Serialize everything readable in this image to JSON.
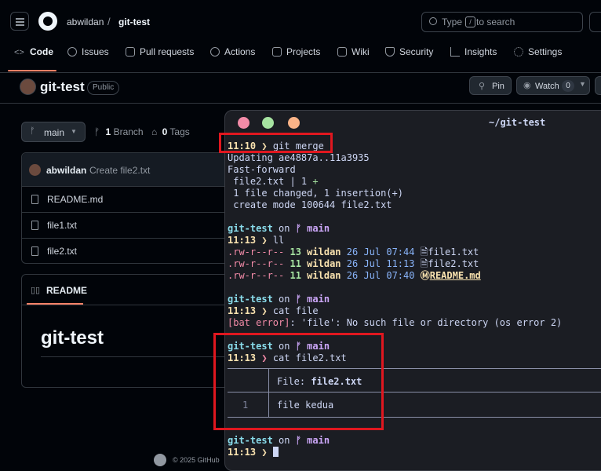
{
  "header": {
    "owner": "abwildan",
    "separator": "/",
    "repo": "git-test",
    "search_placeholder_a": "Type",
    "search_key": "/",
    "search_placeholder_b": "to search"
  },
  "nav_tabs": [
    {
      "label": "Code",
      "icon": "code-icon"
    },
    {
      "label": "Issues",
      "icon": "issue-icon"
    },
    {
      "label": "Pull requests",
      "icon": "pull-request-icon"
    },
    {
      "label": "Actions",
      "icon": "play-icon"
    },
    {
      "label": "Projects",
      "icon": "table-icon"
    },
    {
      "label": "Wiki",
      "icon": "book-icon"
    },
    {
      "label": "Security",
      "icon": "shield-icon"
    },
    {
      "label": "Insights",
      "icon": "graph-icon"
    },
    {
      "label": "Settings",
      "icon": "gear-icon"
    }
  ],
  "repo": {
    "name": "git-test",
    "visibility": "Public",
    "pin_label": "Pin",
    "watch_label": "Watch",
    "watch_count": "0"
  },
  "branch": {
    "current": "main",
    "branch_count": "1",
    "branch_label": "Branch",
    "tag_count": "0",
    "tag_label": "Tags"
  },
  "commit": {
    "author": "abwildan",
    "message": "Create file2.txt"
  },
  "files": [
    "README.md",
    "file1.txt",
    "file2.txt"
  ],
  "readme": {
    "tab_label": "README",
    "heading": "git-test"
  },
  "footer": {
    "text": "© 2025 GitHub"
  },
  "terminal": {
    "title": "~/git-test",
    "colors": {
      "close": "#f38ba8",
      "minimize": "#a6e3a1",
      "maximize": "#fab387",
      "highlight": "#e0171f"
    },
    "lines": {
      "l1_time": "11:10",
      "l1_arrow": "❯",
      "l1_cmd": "git merge",
      "l2": "Updating ae4887a..11a3935",
      "l3": "Fast-forward",
      "l4_a": " file2.txt | 1 ",
      "l4_plus": "+",
      "l5": " 1 file changed, 1 insertion(+)",
      "l6": " create mode 100644 file2.txt",
      "p_dir": "git-test",
      "p_on": "on",
      "p_branch_icon": "ᚠ",
      "p_branch": "main",
      "l8_time": "11:13",
      "l8_cmd": "ll",
      "ll_rows": [
        {
          "perm": ".rw-r--r--",
          "size": "13",
          "user": "wildan",
          "date": "26 Jul 07:44",
          "icon": "🗎",
          "name": "file1.txt"
        },
        {
          "perm": ".rw-r--r--",
          "size": "11",
          "user": "wildan",
          "date": "26 Jul 11:13",
          "icon": "🗎",
          "name": "file2.txt"
        },
        {
          "perm": ".rw-r--r--",
          "size": "11",
          "user": "wildan",
          "date": "26 Jul 07:40",
          "icon": "Ⓜ",
          "name": "README.md"
        }
      ],
      "l14_time": "11:13",
      "l14_cmd": "cat file",
      "l15_err": "[bat error]",
      "l15_msg": ": 'file': No such file or directory (os error 2)",
      "l18_time": "11:13",
      "l18_cmd": "cat file2.txt",
      "bat_file_label": "File: ",
      "bat_file_name": "file2.txt",
      "bat_line_no": "1",
      "bat_line": "file kedua",
      "l_last_time": "11:13"
    }
  }
}
